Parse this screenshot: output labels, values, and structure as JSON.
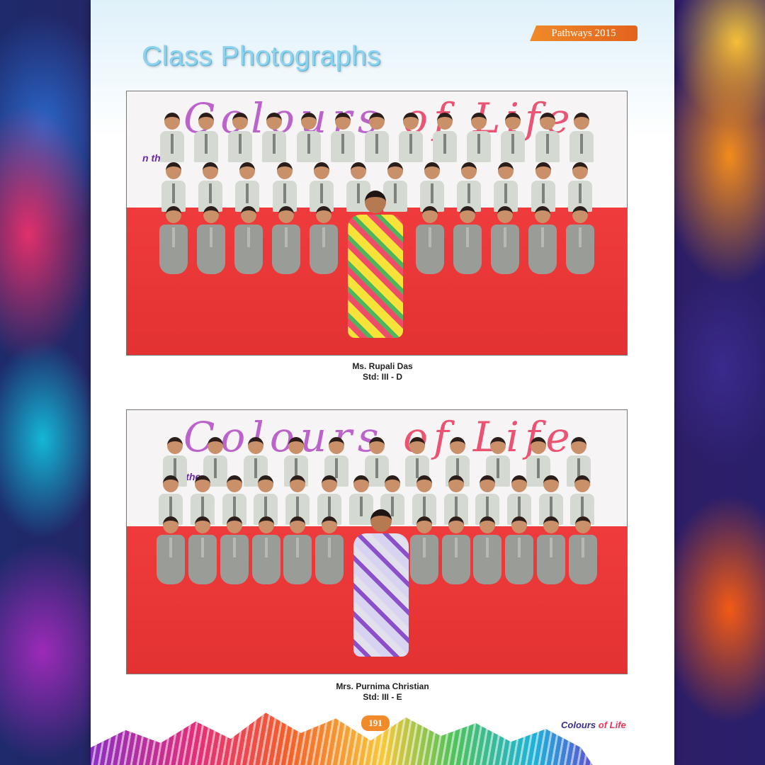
{
  "header": {
    "badge": "Pathways 2015",
    "title": "Class Photographs"
  },
  "photos": [
    {
      "banner_a": "Colours",
      "banner_b": "of Life",
      "sub_banner": "n the",
      "teacher": "Ms. Rupali Das",
      "standard": "Std: III - D"
    },
    {
      "banner_a": "Colours",
      "banner_b": "of Life",
      "sub_banner": "On the",
      "teacher": "Mrs. Purnima Christian",
      "standard": "Std: III - E"
    }
  ],
  "footer": {
    "page_number": "191",
    "logo_a": "Colours",
    "logo_b": "of Life"
  }
}
